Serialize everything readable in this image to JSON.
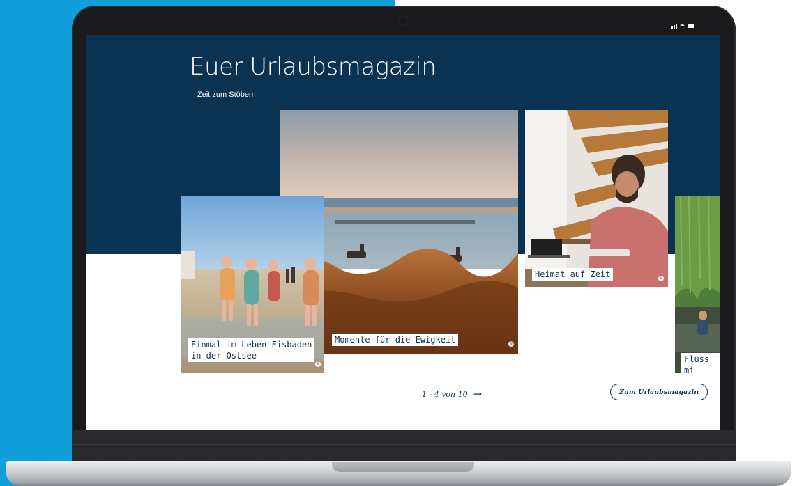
{
  "colors": {
    "brand_navy": "#0a3253",
    "background_blue": "#119fdc",
    "white": "#ffffff"
  },
  "status_icons": [
    "signal-icon",
    "wifi-icon",
    "battery-icon"
  ],
  "header": {
    "title": "Euer Urlaubsmagazin",
    "subtitle": "Zeit zum Stöbern"
  },
  "cards": [
    {
      "caption": "Einmal im Leben Eisbaden\nin der Ostsee",
      "image": "beach-bathers-photo",
      "copyright_icon": "copyright-icon"
    },
    {
      "caption": "Momente für die Ewigkeit",
      "image": "deer-mudflat-photo",
      "copyright_icon": "copyright-icon"
    },
    {
      "caption": "Heimat auf Zeit",
      "image": "man-writing-photo",
      "copyright_icon": "copyright-icon"
    },
    {
      "caption": "Fluss mi",
      "image": "river-willow-photo"
    }
  ],
  "pagination": {
    "label": "1 - 4 von 10",
    "next_icon": "arrow-right-icon"
  },
  "cta_label": "Zum Urlaubsmagazin"
}
